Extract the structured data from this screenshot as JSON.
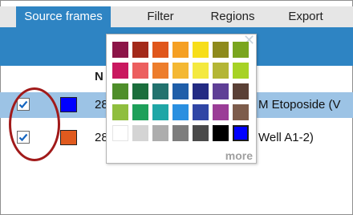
{
  "tabs": [
    "Source frames",
    "Filter",
    "Regions",
    "Export"
  ],
  "table": {
    "column_header": "N",
    "rows": [
      {
        "checked": true,
        "color": "#0000ff",
        "id_fragment": "28",
        "name_fragment": "M Etoposide (V"
      },
      {
        "checked": true,
        "color": "#e05a1e",
        "id_fragment": "28",
        "name_fragment": "Well A1-2)"
      }
    ]
  },
  "palette": {
    "close_glyph": "✕",
    "more_label": "more",
    "colors": [
      [
        "#8c1548",
        "#a32a1a",
        "#e0561b",
        "#f5a023",
        "#f7de1a",
        "#8e8a1c",
        "#7aa51e"
      ],
      [
        "#c9185f",
        "#ec5f5f",
        "#ed7d2c",
        "#f4b833",
        "#f4e93f",
        "#b4b635",
        "#a7d225"
      ],
      [
        "#4e8e2a",
        "#1b6e3c",
        "#22726e",
        "#1f5ea9",
        "#232b83",
        "#5f3f96",
        "#5a4036"
      ],
      [
        "#8fbe3e",
        "#1ea05a",
        "#1fa6a6",
        "#2a8fe0",
        "#3046a5",
        "#9b3d97",
        "#7d5c4b"
      ],
      [
        "#ffffff",
        "#d4d4d4",
        "#adadad",
        "#7d7d7d",
        "#4a4a4a",
        "#000000",
        "#0000ff"
      ]
    ],
    "selected_color": "#0000ff"
  },
  "annotation_color": "#a11a1a"
}
